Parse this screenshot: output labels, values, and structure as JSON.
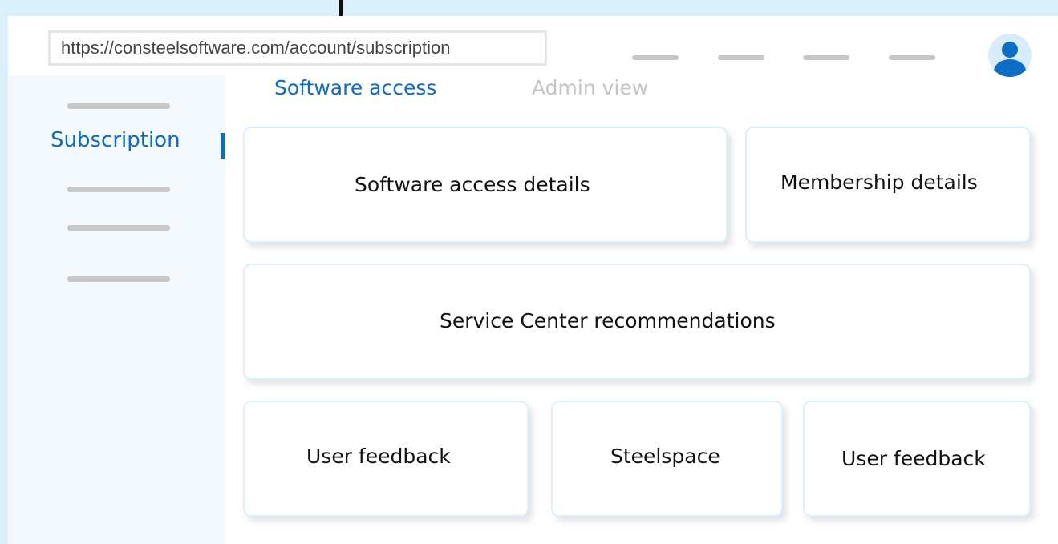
{
  "browser": {
    "url": "https://consteelsoftware.com/account/subscription"
  },
  "header": {
    "avatar_icon": "user-avatar-icon"
  },
  "sidebar": {
    "active_item": "Subscription"
  },
  "tabs": [
    {
      "label": "Software access",
      "active": true
    },
    {
      "label": "Admin view",
      "active": false
    }
  ],
  "cards": {
    "software_access_details": "Software access details",
    "membership_details": "Membership details",
    "service_center": "Service Center recommendations",
    "user_feedback_1": "User feedback",
    "steelspace": "Steelspace",
    "user_feedback_2": "User feedback"
  },
  "colors": {
    "accent": "#0d6cc4",
    "background": "#dcf0fb",
    "sidebar": "#f3f9fd"
  }
}
